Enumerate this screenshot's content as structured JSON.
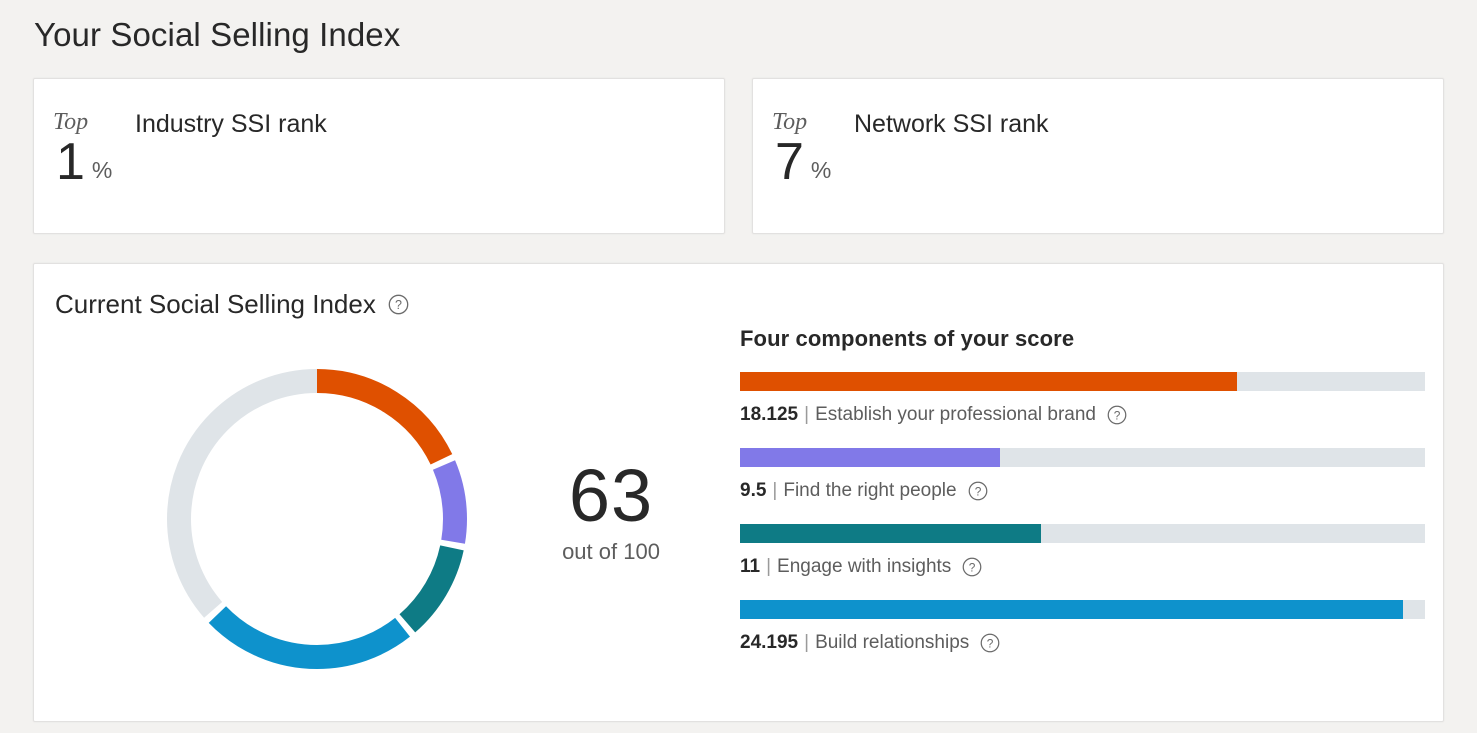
{
  "page": {
    "title": "Your Social Selling Index",
    "background_color": "#f3f2f0"
  },
  "rank_cards": [
    {
      "name": "industry-ssi-rank",
      "top_word": "Top",
      "label": "Industry SSI rank",
      "value": "1",
      "unit": "%"
    },
    {
      "name": "network-ssi-rank",
      "top_word": "Top",
      "label": "Network SSI rank",
      "value": "7",
      "unit": "%"
    }
  ],
  "ssi_panel": {
    "title": "Current Social Selling Index",
    "help_icon": "question-mark-circle-icon",
    "score": "63",
    "score_sub": "out of 100",
    "components_title": "Four components of your score"
  },
  "chart_data": {
    "type": "pie",
    "title": "Current Social Selling Index",
    "subtype": "donut",
    "total": 100,
    "score": 63,
    "score_label": "out of 100",
    "start_angle_deg": 0,
    "direction": "clockwise",
    "categories": [
      "Establish your professional brand",
      "Find the right people",
      "Engage with insights",
      "Build relationships",
      "Remaining"
    ],
    "values": [
      18.125,
      9.5,
      11,
      24.195,
      37.18
    ],
    "colors": [
      "#df5000",
      "#8179e8",
      "#0e7b85",
      "#0e92cc",
      "#dfe4e8"
    ],
    "legend_position": "right-as-bars"
  },
  "components": [
    {
      "score": "18.125",
      "separator": "|",
      "name": "Establish your professional brand",
      "color": "#df5000",
      "max": 25,
      "fill_pct": 72.5,
      "help_icon": "question-mark-circle-icon"
    },
    {
      "score": "9.5",
      "separator": "|",
      "name": "Find the right people",
      "color": "#8179e8",
      "max": 25,
      "fill_pct": 38,
      "help_icon": "question-mark-circle-icon"
    },
    {
      "score": "11",
      "separator": "|",
      "name": "Engage with insights",
      "color": "#0e7b85",
      "max": 25,
      "fill_pct": 44,
      "help_icon": "question-mark-circle-icon"
    },
    {
      "score": "24.195",
      "separator": "|",
      "name": "Build relationships",
      "color": "#0e92cc",
      "max": 25,
      "fill_pct": 96.8,
      "help_icon": "question-mark-circle-icon"
    }
  ],
  "colors": {
    "track": "#dfe4e8",
    "text_dark": "#282828",
    "text_gray": "#5d5d5d",
    "card_bg": "#ffffff",
    "card_border": "#e2e1e0"
  }
}
